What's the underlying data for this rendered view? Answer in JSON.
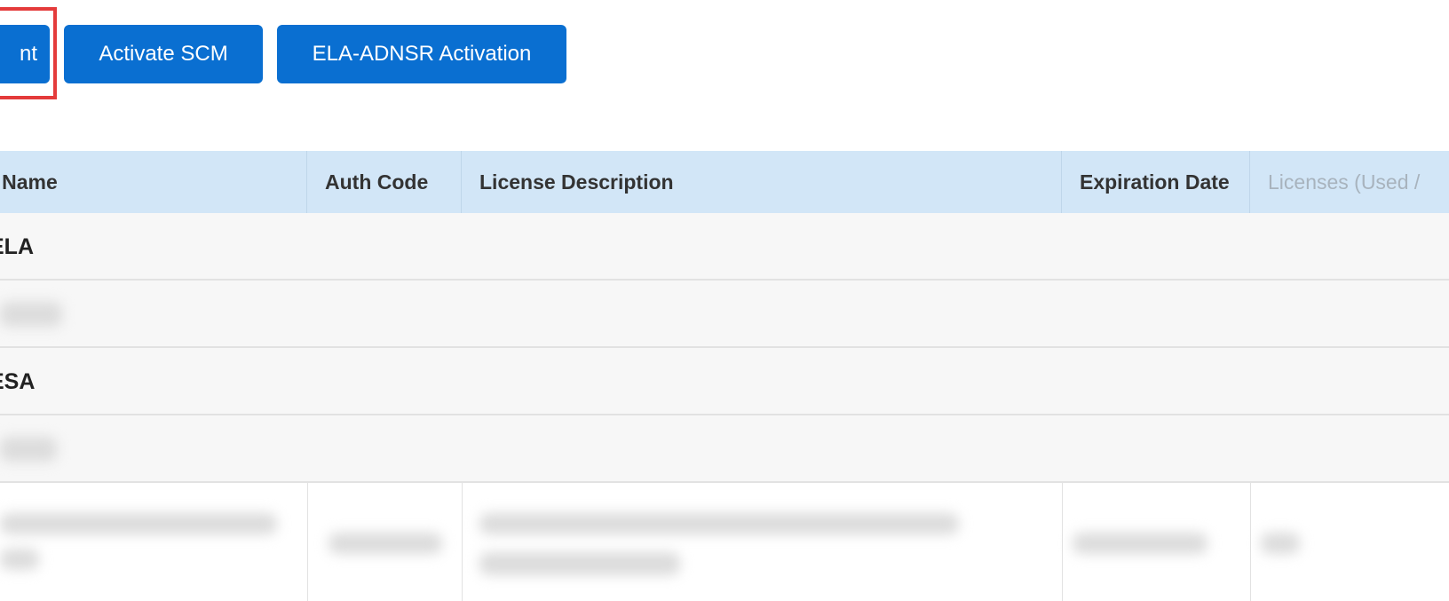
{
  "toolbar": {
    "first_button_label": "nt",
    "activate_scm_label": "Activate SCM",
    "ela_adnsr_label": "ELA-ADNSR Activation"
  },
  "table": {
    "columns": [
      "unt Name",
      "Auth Code",
      "License Description",
      "Expiration Date",
      "Licenses (Used /"
    ],
    "groups": [
      {
        "label": "ELA"
      },
      {
        "label": "ESA"
      }
    ]
  },
  "colors": {
    "button_bg": "#0a6fd1",
    "header_bg": "#d2e6f7",
    "highlight": "#e43b3b",
    "row_bg": "#f7f7f7"
  }
}
